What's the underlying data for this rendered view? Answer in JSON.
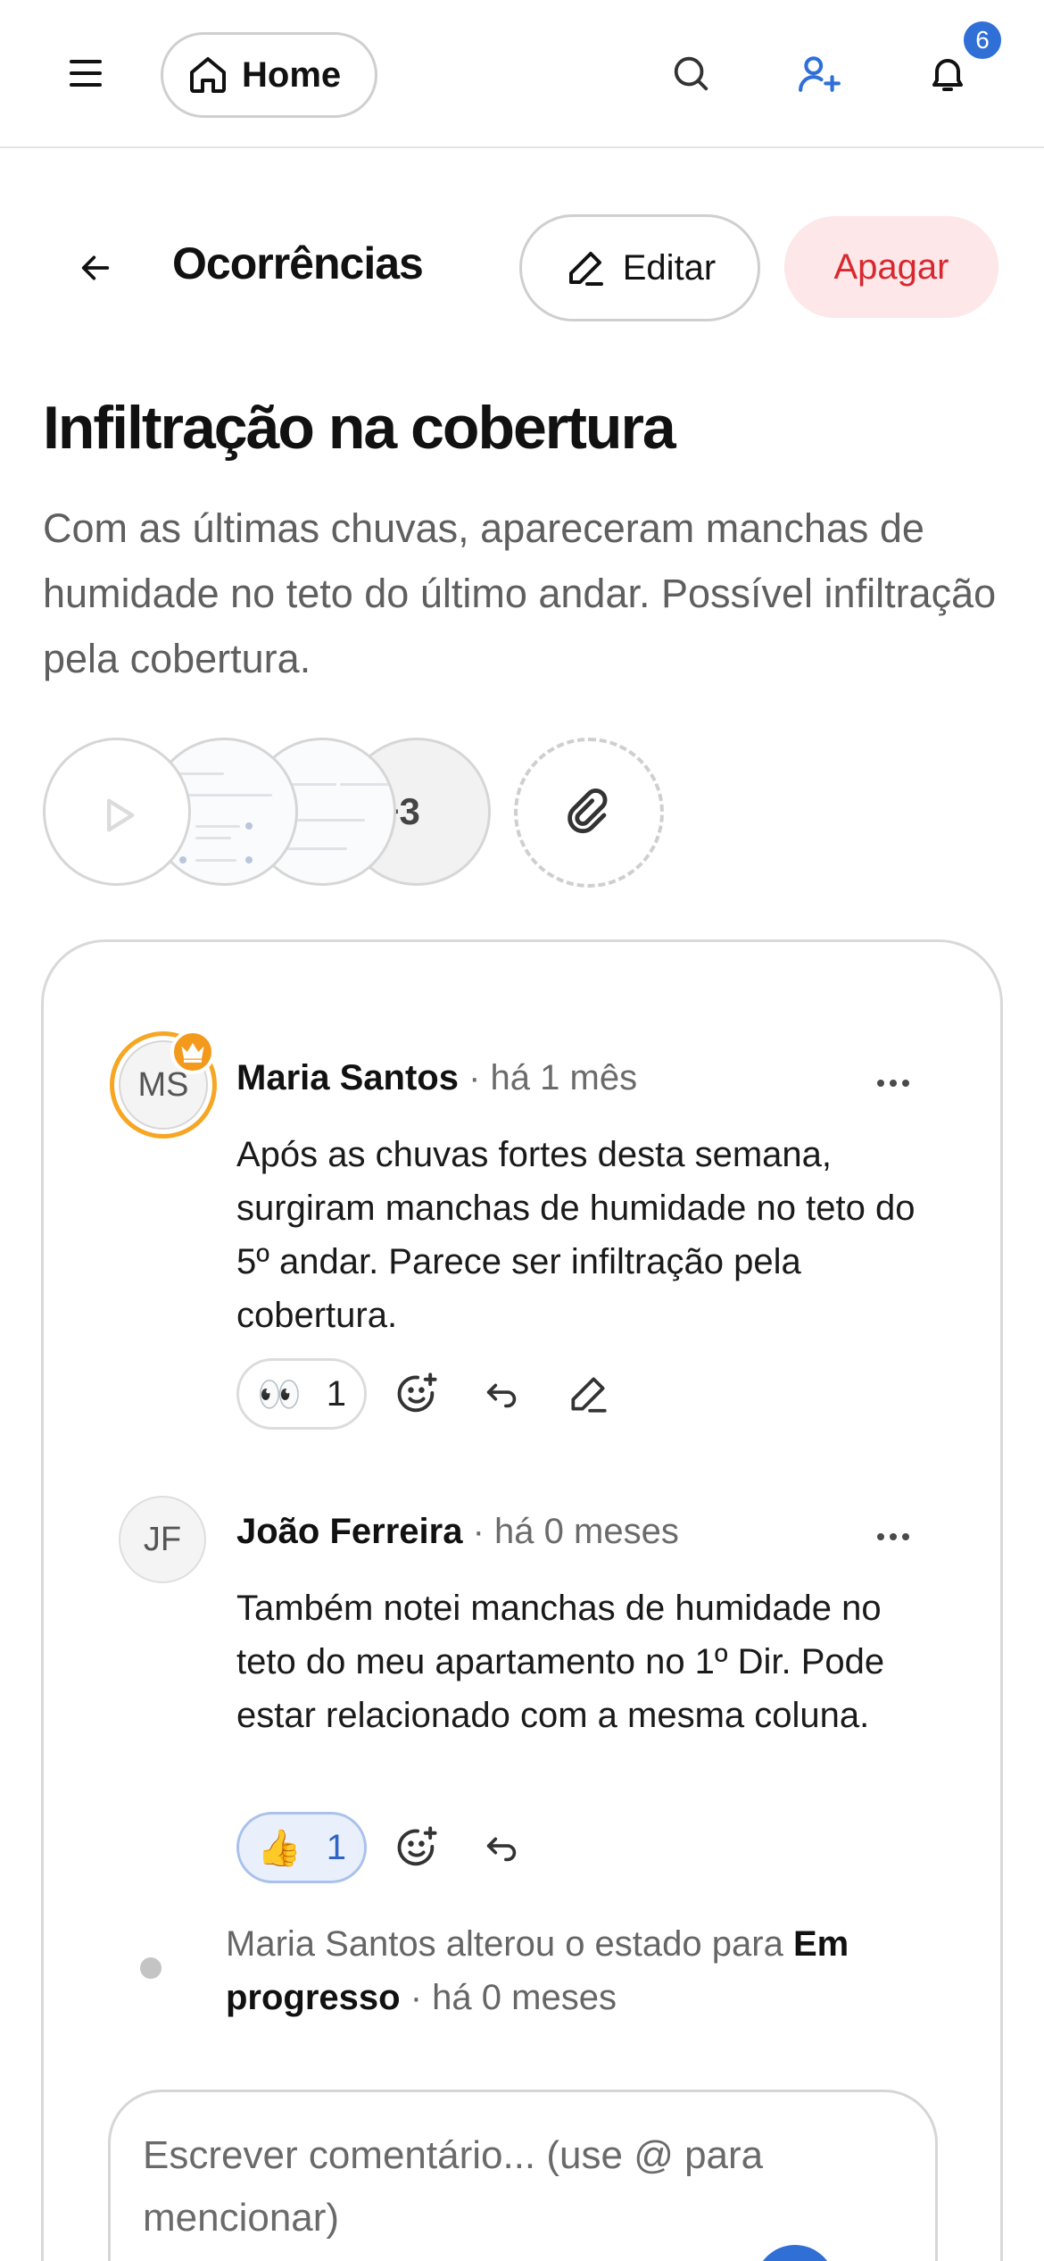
{
  "topbar": {
    "home_label": "Home",
    "notifications_count": "6",
    "icons": [
      "menu-icon",
      "home-icon",
      "search-icon",
      "add-user-icon",
      "bell-icon"
    ],
    "accent_color": "#2f6fd6"
  },
  "header": {
    "title": "Ocorrências",
    "edit_label": "Editar",
    "delete_label": "Apagar",
    "delete_color": "#d8282f"
  },
  "issue": {
    "title": "Infiltração na cobertura",
    "description": "Com as últimas chuvas, apareceram manchas de humidade no teto do último andar. Possível infiltração pela cobertura."
  },
  "attachments": {
    "more_count": "+3"
  },
  "comments": [
    {
      "initials": "MS",
      "author": "Maria Santos",
      "separator": "·",
      "time": "há 1 mês",
      "body": "Após as chuvas fortes desta semana, surgiram manchas de humidade no teto do 5º andar. Parece ser infiltração pela cobertura.",
      "reaction_emoji": "👀",
      "reaction_count": "1",
      "badge_icon": "crown-icon"
    },
    {
      "initials": "JF",
      "author": "João Ferreira",
      "separator": "·",
      "time": "há 0 meses",
      "body": "Também notei manchas de humidade no teto do meu apartamento no 1º Dir. Pode estar relacionado com a mesma coluna.",
      "reaction_emoji": "👍",
      "reaction_count": "1"
    }
  ],
  "status_event": {
    "actor_text": "Maria Santos alterou o estado para",
    "status": "Em progresso",
    "time": "· há 0 meses"
  },
  "composer": {
    "placeholder": "Escrever comentário... (use @ para mencionar)"
  }
}
